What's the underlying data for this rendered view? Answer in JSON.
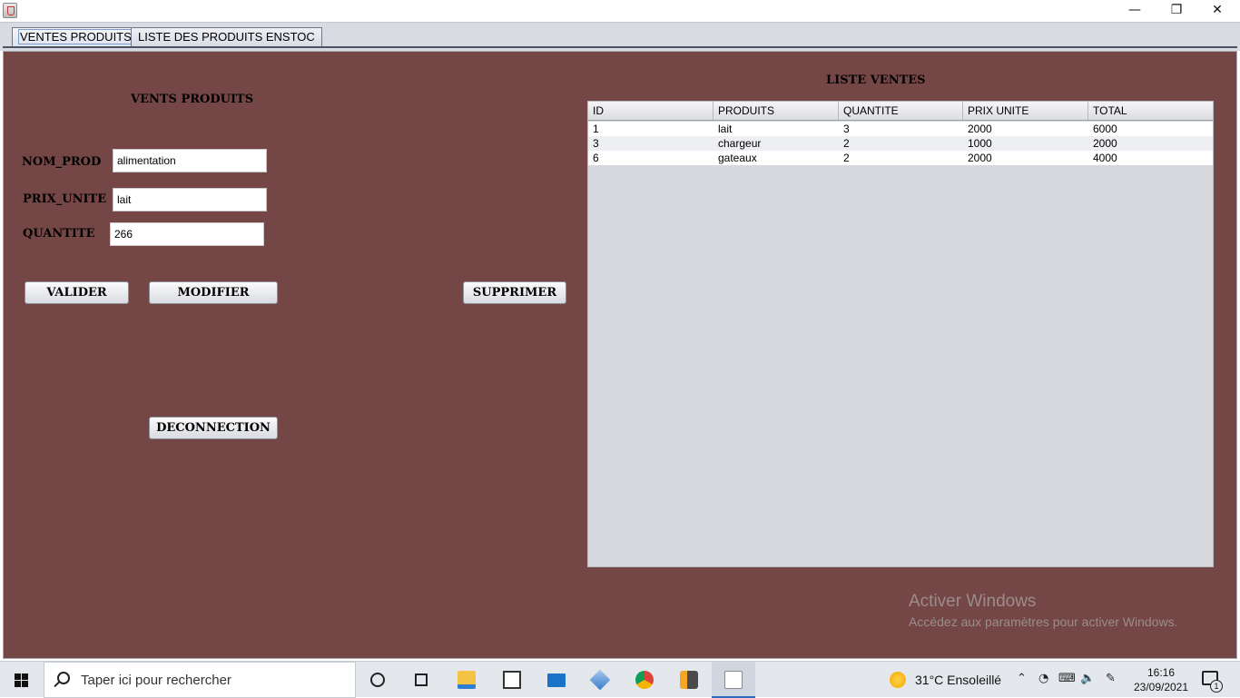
{
  "window": {
    "minimize_glyph": "—",
    "restore_glyph": "❐",
    "close_glyph": "✕"
  },
  "tabs": [
    {
      "label": "VENTES PRODUITS",
      "active": true
    },
    {
      "label": "LISTE DES PRODUITS ENSTOC",
      "active": false
    }
  ],
  "form": {
    "title": "VENTS PRODUITS",
    "nom_prod_label": "NOM_PROD",
    "nom_prod_value": "alimentation",
    "prix_unite_label": "PRIX_UNITE",
    "prix_unite_value": "lait",
    "quantite_label": "QUANTITE",
    "quantite_value": "266"
  },
  "buttons": {
    "valider": "VALIDER",
    "modifier": "MODIFIER",
    "supprimer": "SUPPRIMER",
    "deconnection": "DECONNECTION"
  },
  "table": {
    "title": "LISTE VENTES",
    "columns": [
      "ID",
      "PRODUITS",
      "QUANTITE",
      "PRIX UNITE",
      "TOTAL"
    ],
    "rows": [
      [
        "1",
        "lait",
        "3",
        "2000",
        "6000"
      ],
      [
        "3",
        "chargeur",
        "2",
        "1000",
        "2000"
      ],
      [
        "6",
        "gateaux",
        "2",
        "2000",
        "4000"
      ]
    ]
  },
  "watermark": {
    "title": "Activer Windows",
    "subtitle": "Accédez aux paramètres pour activer Windows."
  },
  "taskbar": {
    "search_placeholder": "Taper ici pour rechercher",
    "weather": "31°C  Ensoleillé",
    "time": "16:16",
    "date": "23/09/2021",
    "notification_count": "1",
    "icons": [
      "cortana-icon",
      "task-view-icon",
      "file-explorer-icon",
      "store-icon",
      "mail-icon",
      "virtualbox-icon",
      "chrome-icon",
      "sublime-text-icon",
      "java-app-icon"
    ]
  },
  "colors": {
    "panel_background": "#744646",
    "tab_strip": "#d9dbe2",
    "taskbar": "#e4e8ed"
  }
}
